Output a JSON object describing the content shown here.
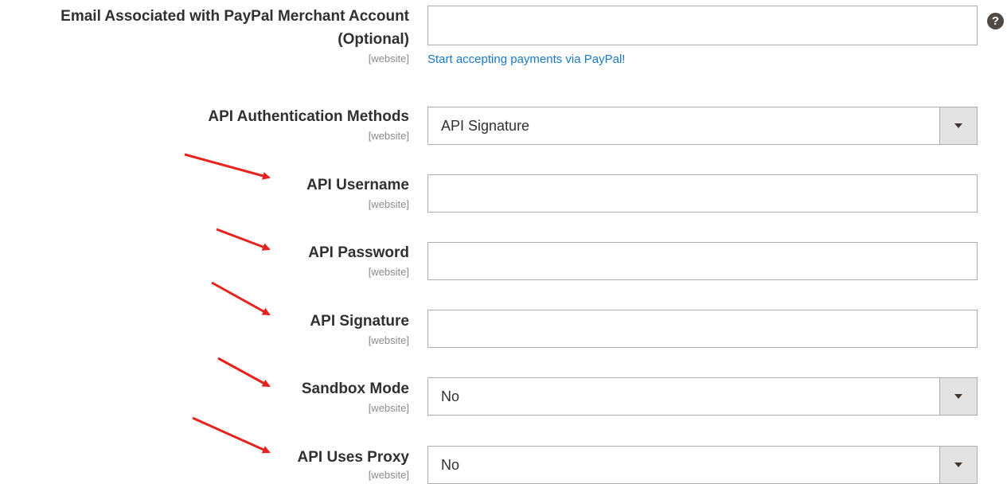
{
  "email": {
    "label_line1": "Email Associated with PayPal Merchant Account",
    "label_line2": "(Optional)",
    "scope": "[website]",
    "value": "",
    "link_text": "Start accepting payments via PayPal!",
    "help_icon": "question-circle-icon"
  },
  "auth_methods": {
    "label": "API Authentication Methods",
    "scope": "[website]",
    "value": "API Signature"
  },
  "username": {
    "label": "API Username",
    "scope": "[website]",
    "value": ""
  },
  "password": {
    "label": "API Password",
    "scope": "[website]",
    "value": ""
  },
  "signature": {
    "label": "API Signature",
    "scope": "[website]",
    "value": ""
  },
  "sandbox": {
    "label": "Sandbox Mode",
    "scope": "[website]",
    "value": "No"
  },
  "proxy": {
    "label": "API Uses Proxy",
    "scope": "[website]",
    "value": "No"
  },
  "colors": {
    "accent_link": "#1979c3",
    "annotation_arrow": "#e8231f"
  }
}
